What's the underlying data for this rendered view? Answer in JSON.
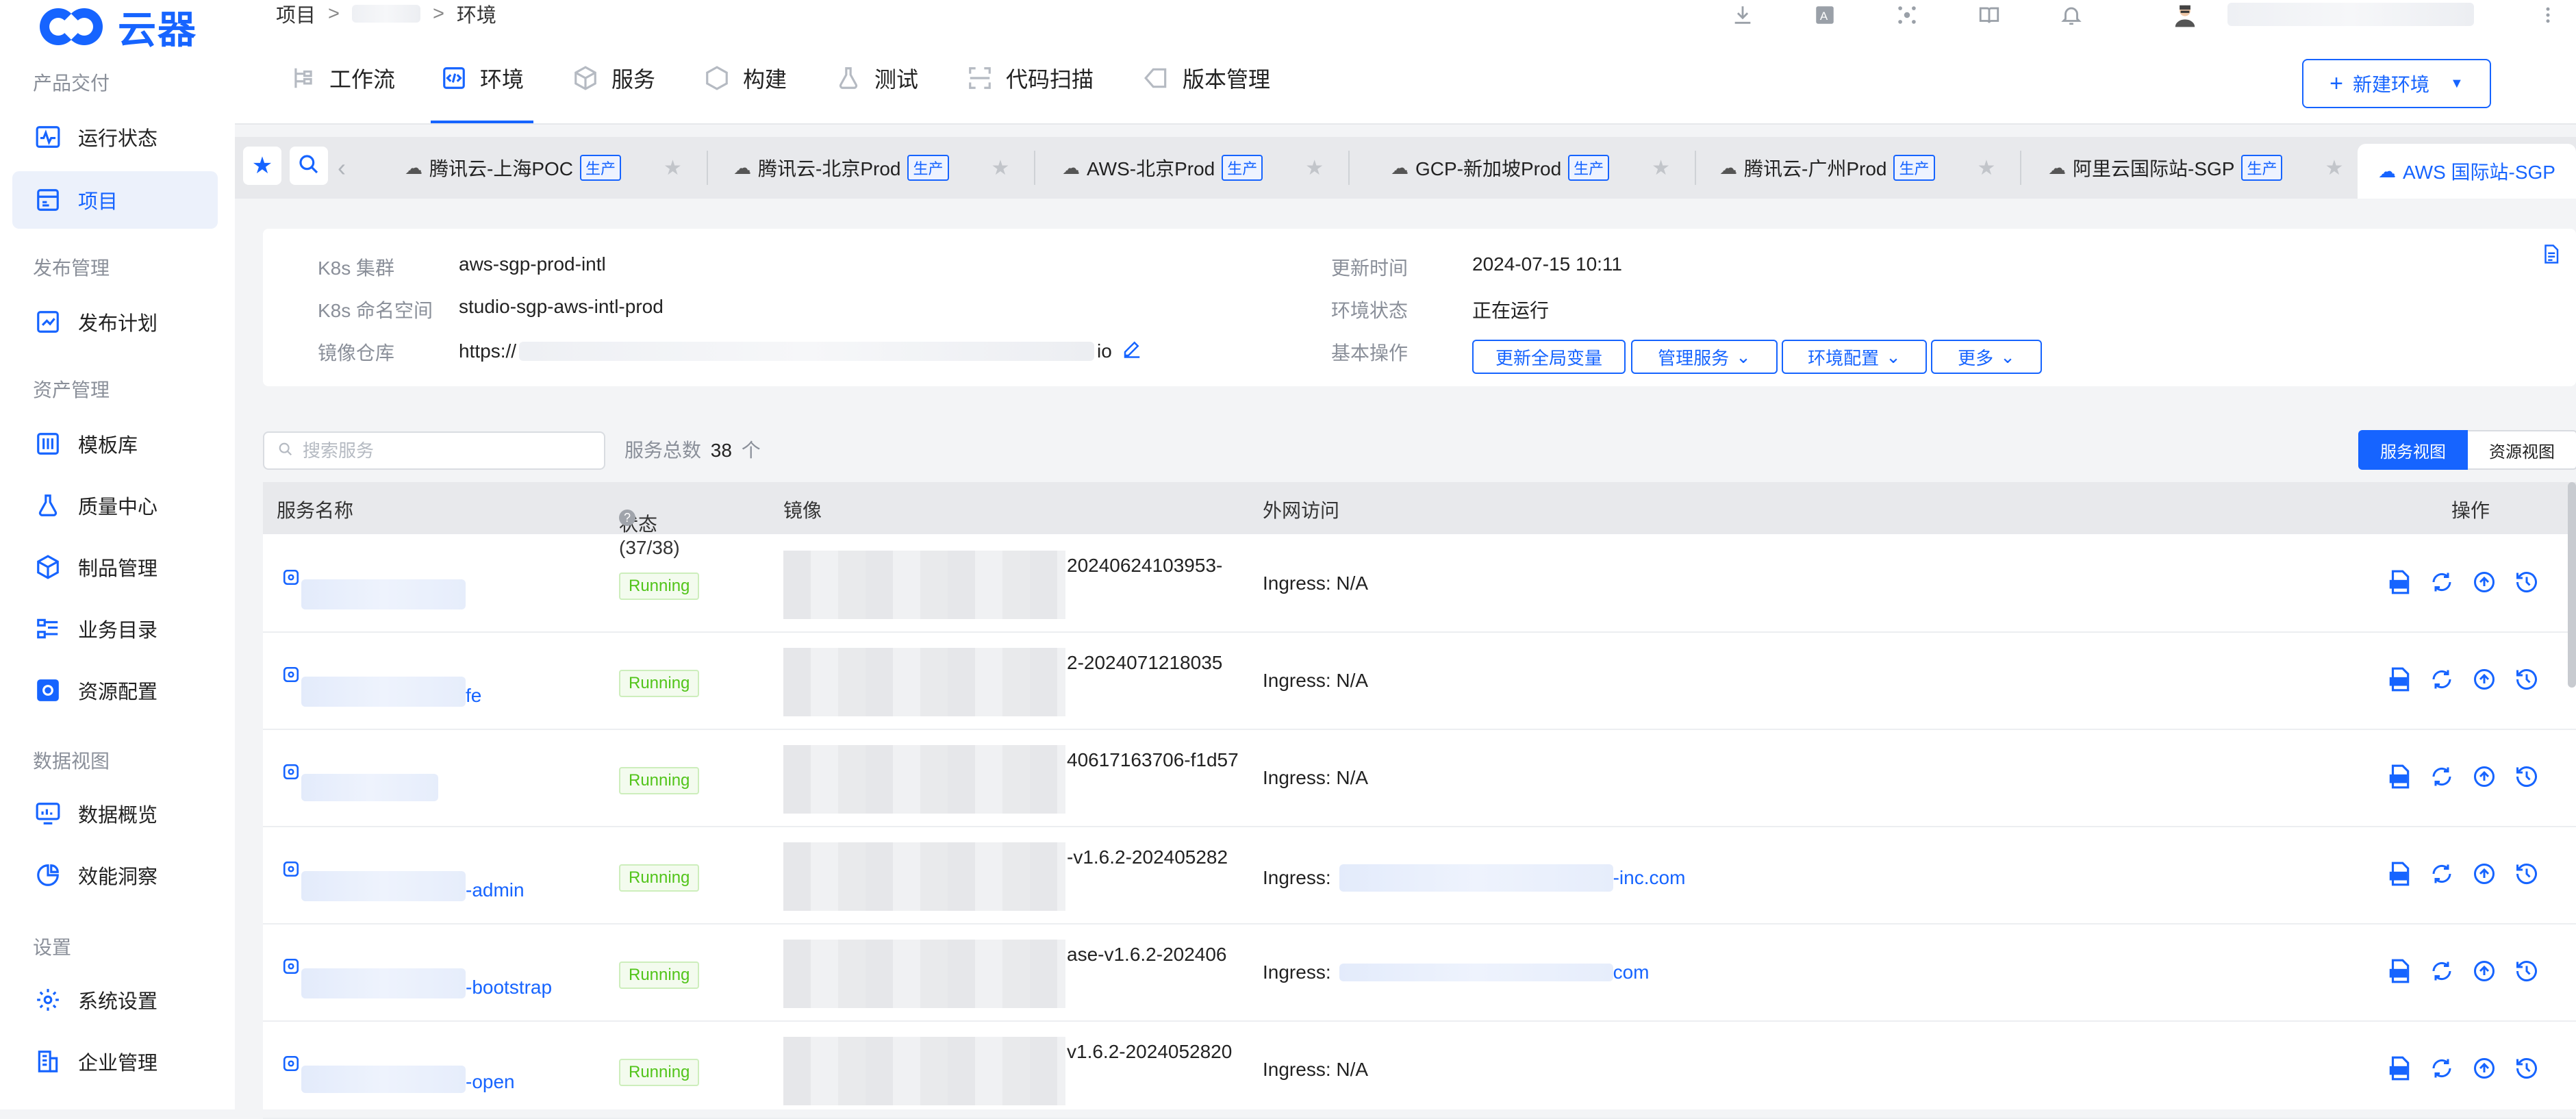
{
  "brand": {
    "name": "云器"
  },
  "sidebar": {
    "sections": [
      {
        "title": "产品交付",
        "items": [
          {
            "label": "运行状态",
            "icon": "pulse-chart-icon"
          },
          {
            "label": "项目",
            "icon": "project-icon",
            "active": true
          }
        ]
      },
      {
        "title": "发布管理",
        "items": [
          {
            "label": "发布计划",
            "icon": "release-plan-icon"
          }
        ]
      },
      {
        "title": "资产管理",
        "items": [
          {
            "label": "模板库",
            "icon": "template-icon"
          },
          {
            "label": "质量中心",
            "icon": "flask-icon"
          },
          {
            "label": "制品管理",
            "icon": "artifact-icon"
          },
          {
            "label": "业务目录",
            "icon": "catalog-icon"
          },
          {
            "label": "资源配置",
            "icon": "resource-gear-icon"
          }
        ]
      },
      {
        "title": "数据视图",
        "items": [
          {
            "label": "数据概览",
            "icon": "dashboard-icon"
          },
          {
            "label": "效能洞察",
            "icon": "pie-icon"
          }
        ]
      },
      {
        "title": "设置",
        "items": [
          {
            "label": "系统设置",
            "icon": "gear-icon"
          },
          {
            "label": "企业管理",
            "icon": "building-icon"
          }
        ]
      }
    ]
  },
  "breadcrumb": {
    "root": "项目",
    "sep": ">",
    "current": "环境"
  },
  "subnav": {
    "tabs": [
      {
        "label": "工作流",
        "icon": "workflow-icon"
      },
      {
        "label": "环境",
        "icon": "code-env-icon",
        "active": true
      },
      {
        "label": "服务",
        "icon": "cube-icon"
      },
      {
        "label": "构建",
        "icon": "box-icon"
      },
      {
        "label": "测试",
        "icon": "beaker-icon"
      },
      {
        "label": "代码扫描",
        "icon": "scan-icon"
      },
      {
        "label": "版本管理",
        "icon": "tag-icon"
      }
    ],
    "new_env_label": "新建环境"
  },
  "env_tabs": [
    {
      "label": "腾讯云-上海POC",
      "badge": "生产"
    },
    {
      "label": "腾讯云-北京Prod",
      "badge": "生产"
    },
    {
      "label": "AWS-北京Prod",
      "badge": "生产"
    },
    {
      "label": "GCP-新加坡Prod",
      "badge": "生产"
    },
    {
      "label": "腾讯云-广州Prod",
      "badge": "生产"
    },
    {
      "label": "阿里云国际站-SGP",
      "badge": "生产"
    },
    {
      "label": "AWS 国际站-SGP",
      "active": true
    }
  ],
  "info": {
    "k8s_cluster_label": "K8s 集群",
    "k8s_cluster": "aws-sgp-prod-intl",
    "k8s_ns_label": "K8s 命名空间",
    "k8s_ns": "studio-sgp-aws-intl-prod",
    "registry_label": "镜像仓库",
    "registry_prefix": "https://",
    "registry_suffix": "io",
    "updated_label": "更新时间",
    "updated": "2024-07-15 10:11",
    "state_label": "环境状态",
    "state": "正在运行",
    "ops_label": "基本操作",
    "ops": {
      "update_vars": "更新全局变量",
      "manage_svc": "管理服务",
      "env_config": "环境配置",
      "more": "更多"
    }
  },
  "list": {
    "search_placeholder": "搜索服务",
    "count_label": "服务总数",
    "count": "38",
    "count_unit": "个",
    "view_service": "服务视图",
    "view_resource": "资源视图",
    "columns": {
      "name": "服务名称",
      "status": "状态(37/38)",
      "image": "镜像",
      "access": "外网访问",
      "ops": "操作"
    },
    "rows": [
      {
        "name_suffix": "",
        "status": "Running",
        "image_tail": "20240624103953-",
        "access_prefix": "Ingress: N/A",
        "access_link": ""
      },
      {
        "name_suffix": "fe",
        "status": "Running",
        "image_tail": "2-2024071218035",
        "access_prefix": "Ingress: N/A",
        "access_link": ""
      },
      {
        "name_suffix": "",
        "status": "Running",
        "image_tail": "40617163706-f1d57",
        "access_prefix": "Ingress: N/A",
        "access_link": ""
      },
      {
        "name_suffix": "-admin",
        "status": "Running",
        "image_tail": "-v1.6.2-202405282",
        "access_prefix": "Ingress:",
        "access_link": "-inc.com"
      },
      {
        "name_suffix": "-bootstrap",
        "status": "Running",
        "image_tail": "ase-v1.6.2-202406",
        "access_prefix": "Ingress:",
        "access_link": "com"
      },
      {
        "name_suffix": "-open",
        "status": "Running",
        "image_tail": "v1.6.2-2024052820",
        "access_prefix": "Ingress: N/A",
        "access_link": ""
      }
    ]
  }
}
